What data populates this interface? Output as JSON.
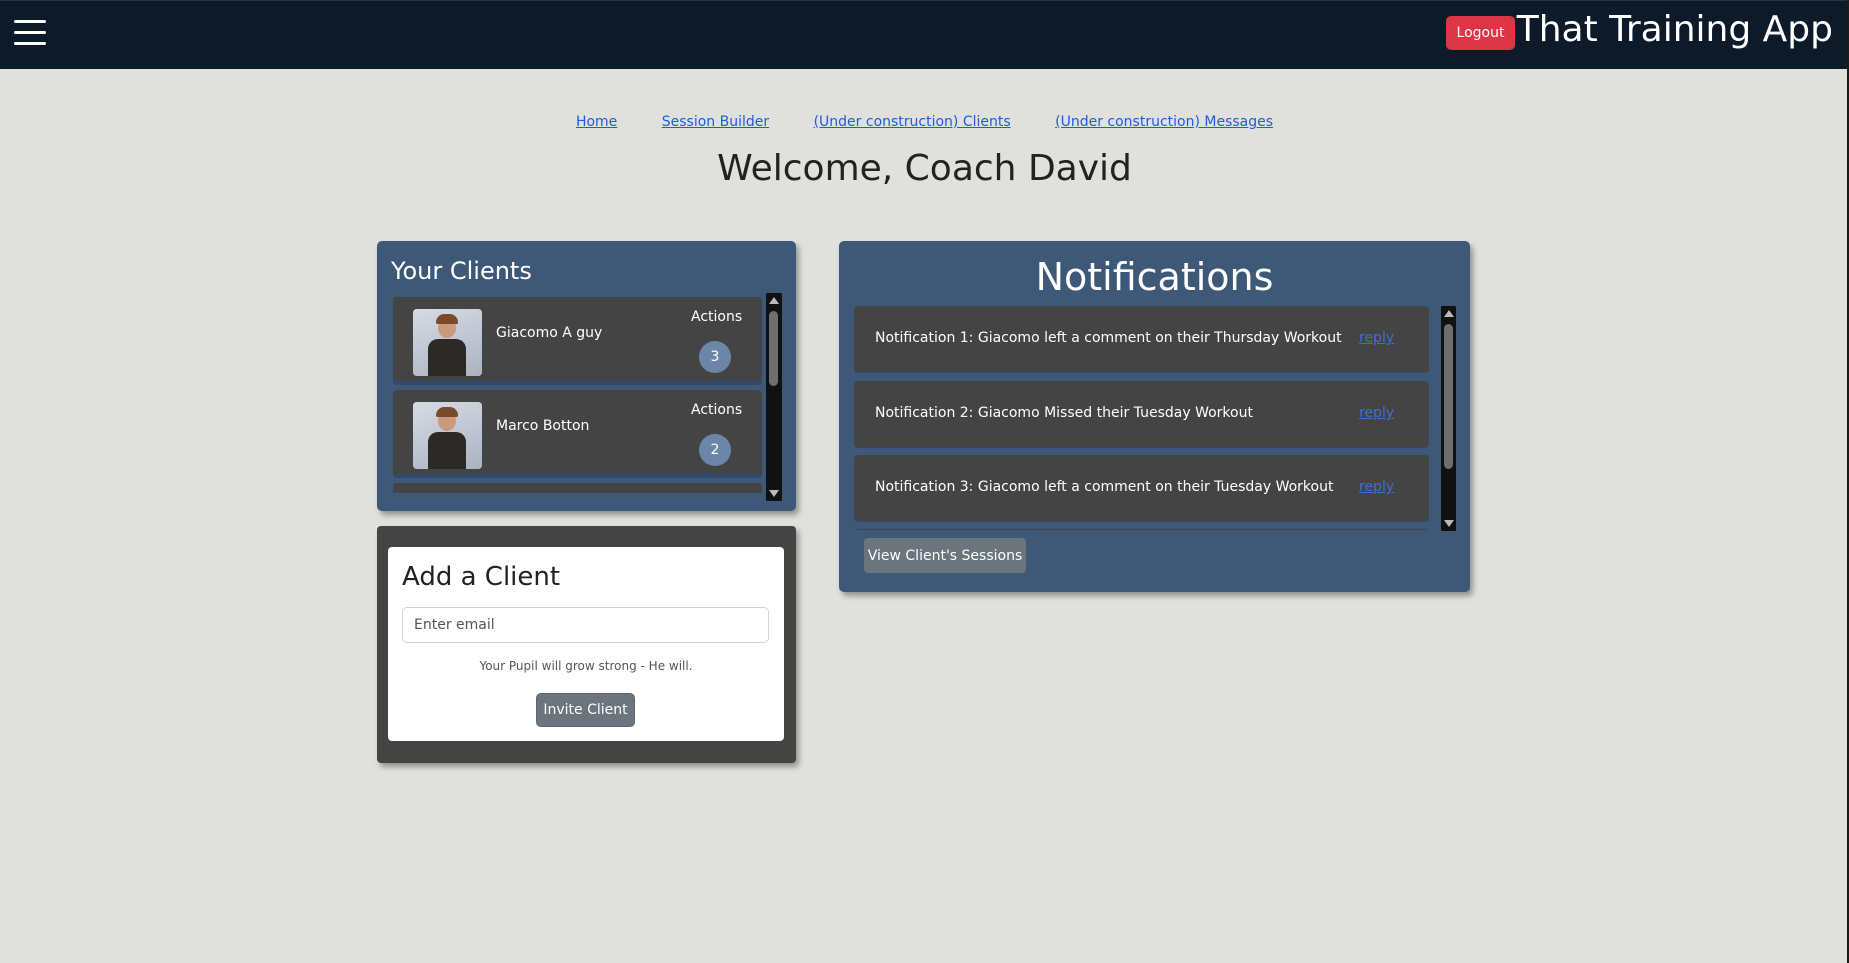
{
  "header": {
    "menu_icon": "hamburger-menu-icon",
    "logout_label": "Logout",
    "brand": "That Training App",
    "colors": {
      "bar": "#0d1a2a",
      "logout": "#dc3545"
    }
  },
  "nav": {
    "links": [
      {
        "label": "Home"
      },
      {
        "label": "Session Builder"
      },
      {
        "label": "(Under construction) Clients"
      },
      {
        "label": "(Under construction) Messages"
      }
    ]
  },
  "welcome": "Welcome, Coach David",
  "clients": {
    "title": "Your Clients",
    "items": [
      {
        "name": "Giacomo A guy",
        "actions_label": "Actions",
        "actions_count": "3",
        "avatar": "client-avatar"
      },
      {
        "name": "Marco Botton",
        "actions_label": "Actions",
        "actions_count": "2",
        "avatar": "client-avatar"
      }
    ]
  },
  "add_client": {
    "title": "Add a Client",
    "email_placeholder": "Enter email",
    "hint": "Your Pupil will grow strong - He will.",
    "invite_label": "Invite Client"
  },
  "notifications": {
    "title": "Notifications",
    "items": [
      {
        "text": "Notification 1: Giacomo left a comment on their Thursday Workout",
        "reply": "reply"
      },
      {
        "text": "Notification 2: Giacomo Missed their Tuesday Workout",
        "reply": "reply"
      },
      {
        "text": "Notification 3: Giacomo left a comment on their Tuesday Workout",
        "reply": "reply"
      }
    ],
    "view_sessions_label": "View Client's Sessions"
  },
  "colors": {
    "panel": "#3e5878",
    "card": "#444444",
    "page_bg": "#e0e0dc"
  }
}
